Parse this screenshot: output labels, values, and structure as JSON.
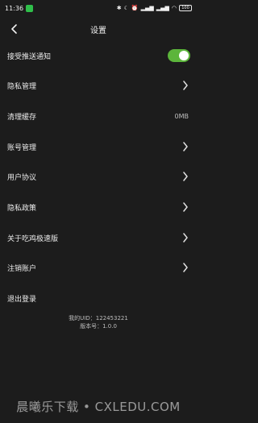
{
  "status_bar": {
    "time": "11:36",
    "battery": "100",
    "network": "4G"
  },
  "header": {
    "title": "设置"
  },
  "settings": {
    "receive_push": "接受推送通知",
    "privacy_management": "隐私管理",
    "clear_cache": "清理缓存",
    "cache_size": "0MB",
    "account_management": "账号管理",
    "user_agreement": "用户协议",
    "privacy_policy": "隐私政策",
    "about": "关于吃鸡极速版",
    "cancel_account": "注销账户",
    "logout": "退出登录"
  },
  "footer": {
    "uid_line": "我的UID：122453221",
    "version_line": "版本号：1.0.0"
  },
  "watermark": "晨曦乐下载 • CXLEDU.COM",
  "colors": {
    "background": "#1c1c1c",
    "toggle_on": "#5cb53b"
  }
}
